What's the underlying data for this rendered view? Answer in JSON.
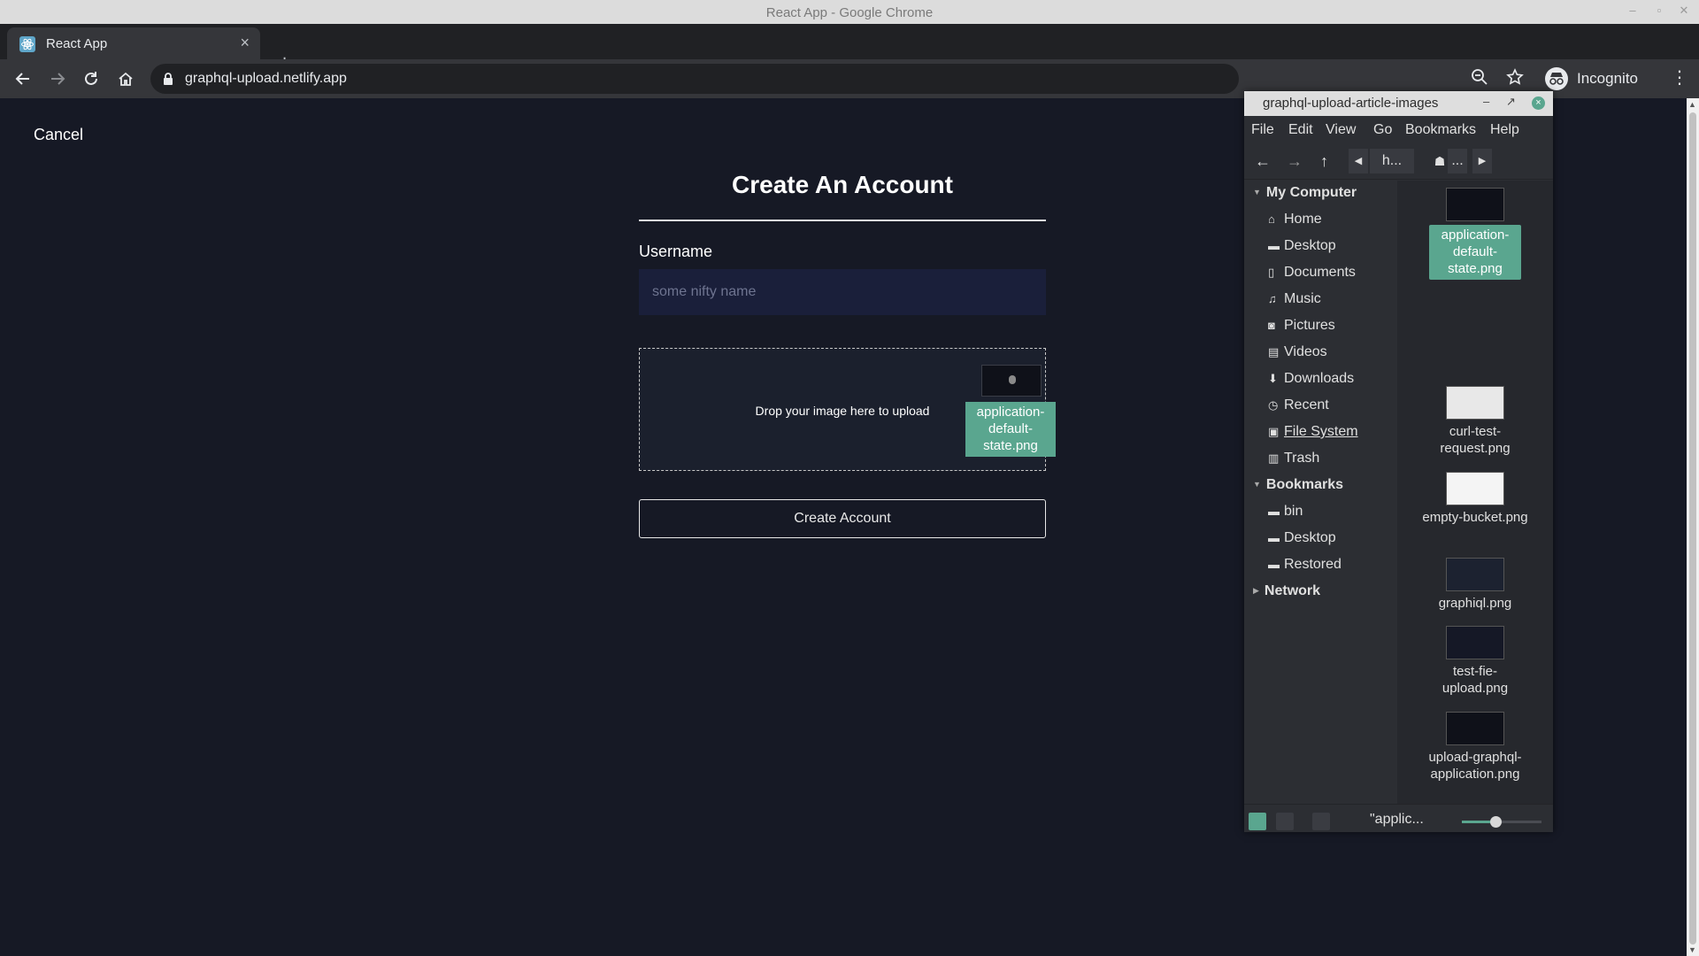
{
  "window": {
    "title": "React App - Google Chrome"
  },
  "browser": {
    "tab_title": "React App",
    "url": "graphql-upload.netlify.app",
    "incognito_label": "Incognito"
  },
  "page": {
    "cancel_label": "Cancel",
    "heading": "Create An Account",
    "username_label": "Username",
    "username_placeholder": "some nifty name",
    "username_value": "",
    "dropzone_text": "Drop your image here to upload",
    "drag_file_label": "application-default-state.png",
    "create_button": "Create Account"
  },
  "file_manager": {
    "title": "graphql-upload-article-images",
    "menu": [
      "File",
      "Edit",
      "View",
      "Go",
      "Bookmarks",
      "Help"
    ],
    "breadcrumbs": [
      "h...",
      "..."
    ],
    "sections": [
      {
        "label": "My Computer",
        "items": [
          {
            "label": "Home",
            "icon": "home-icon"
          },
          {
            "label": "Desktop",
            "icon": "folder-icon"
          },
          {
            "label": "Documents",
            "icon": "document-icon"
          },
          {
            "label": "Music",
            "icon": "music-icon"
          },
          {
            "label": "Pictures",
            "icon": "camera-icon"
          },
          {
            "label": "Videos",
            "icon": "video-icon"
          },
          {
            "label": "Downloads",
            "icon": "download-icon"
          },
          {
            "label": "Recent",
            "icon": "clock-icon"
          },
          {
            "label": "File System",
            "icon": "drive-icon"
          },
          {
            "label": "Trash",
            "icon": "trash-icon"
          }
        ]
      },
      {
        "label": "Bookmarks",
        "items": [
          {
            "label": "bin",
            "icon": "folder-icon"
          },
          {
            "label": "Desktop",
            "icon": "folder-icon"
          },
          {
            "label": "Restored",
            "icon": "folder-icon"
          }
        ]
      },
      {
        "label": "Network",
        "items": []
      }
    ],
    "files": [
      {
        "name": "application-default-state.png",
        "selected": true
      },
      {
        "name": "curl-test-request.png",
        "selected": false
      },
      {
        "name": "empty-bucket.png",
        "selected": false
      },
      {
        "name": "graphiql.png",
        "selected": false
      },
      {
        "name": "test-fie-upload.png",
        "selected": false
      },
      {
        "name": "upload-graphql-application.png",
        "selected": false
      }
    ],
    "status_text": "\"applic...",
    "zoom_fraction": 0.42
  },
  "colors": {
    "accent": "#5aa68f",
    "page_bg": "#161925",
    "input_bg": "#1a1f3a"
  }
}
